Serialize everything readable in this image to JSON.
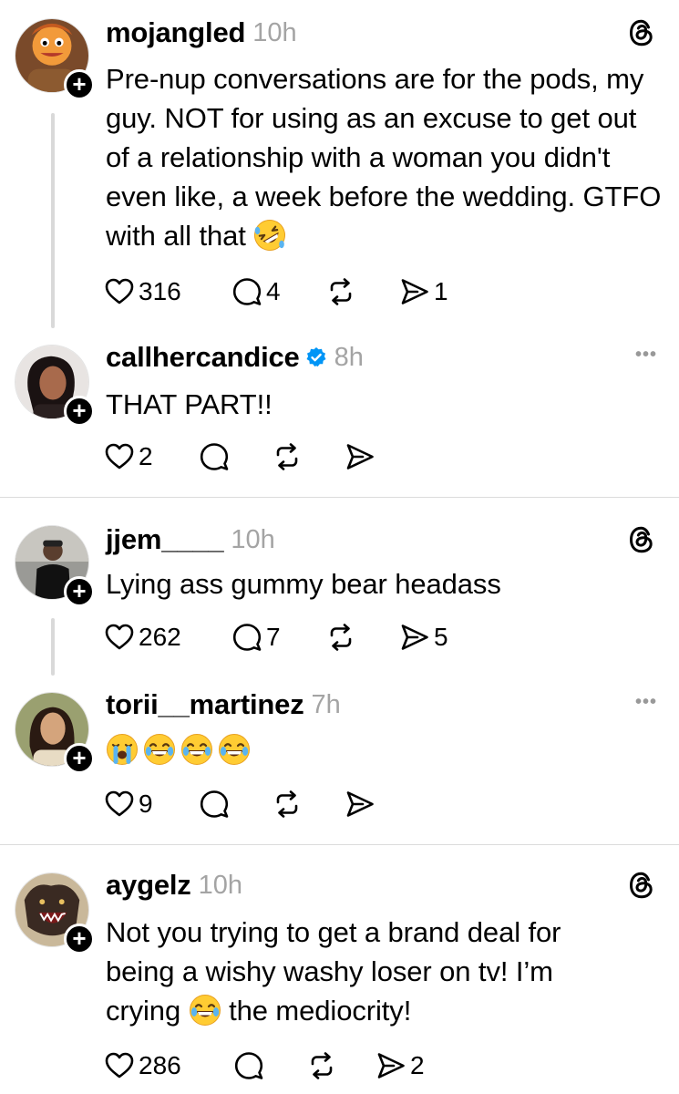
{
  "posts": [
    {
      "username": "mojangled",
      "time": "10h",
      "text": "Pre-nup conversations are for the pods, my guy. NOT for using as an excuse to get out of a relationship with a woman you didn't even like, a week before the wedding. GTFO with all that",
      "likes": "316",
      "replies": "4",
      "reposts": "",
      "shares": "1",
      "corner_icon": "threads-icon"
    },
    {
      "username": "callhercandice",
      "verified": true,
      "time": "8h",
      "text": "THAT PART!!",
      "likes": "2",
      "replies": "",
      "reposts": "",
      "shares": "",
      "corner_icon": "more-icon"
    },
    {
      "username": "jjem____",
      "time": "10h",
      "text": "Lying ass gummy bear headass",
      "likes": "262",
      "replies": "7",
      "reposts": "",
      "shares": "5",
      "corner_icon": "threads-icon"
    },
    {
      "username": "torii__martinez",
      "time": "7h",
      "text": "",
      "emojis": [
        "loudly-crying-face",
        "face-with-tears-of-joy",
        "face-with-tears-of-joy",
        "face-with-tears-of-joy"
      ],
      "likes": "9",
      "replies": "",
      "reposts": "",
      "shares": "",
      "corner_icon": "more-icon"
    },
    {
      "username": "aygelz",
      "time": "10h",
      "text_line1": "Not you trying to get a brand deal for",
      "text_line2": "being a wishy washy loser on tv! I’m",
      "text_line3_a": "crying",
      "text_line3_b": "the mediocrity!",
      "likes": "286",
      "replies": "",
      "reposts": "",
      "shares": "2",
      "corner_icon": "threads-icon"
    }
  ],
  "colors": {
    "time_gray": "#a4a4a4",
    "verified_blue": "#0095f6",
    "divider": "#dcdcdc"
  }
}
